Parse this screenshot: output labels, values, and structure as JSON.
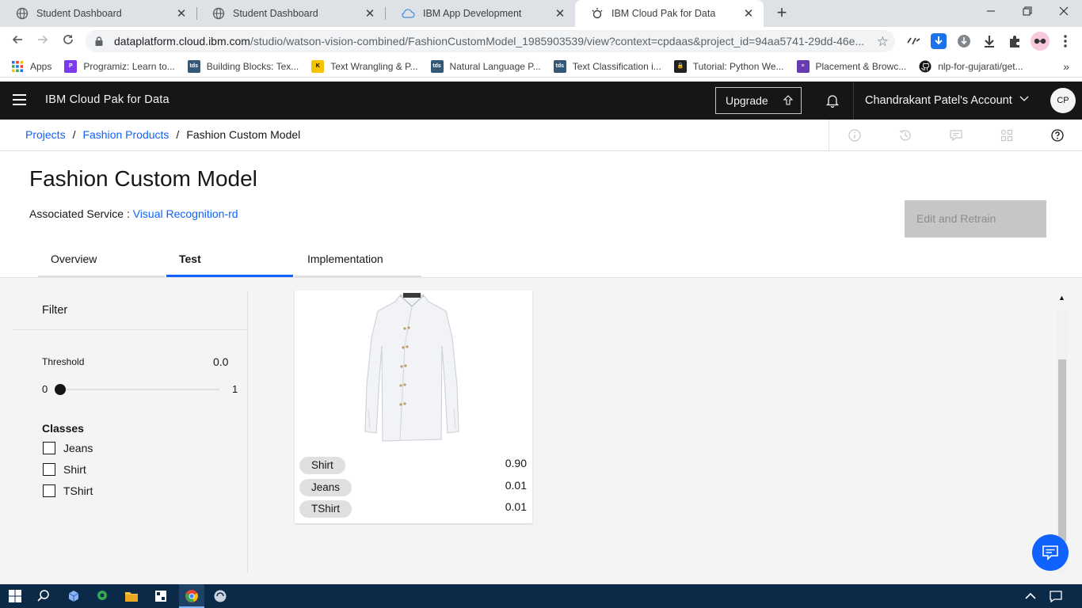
{
  "browser": {
    "tabs": [
      {
        "title": "Student Dashboard",
        "active": false
      },
      {
        "title": "Student Dashboard",
        "active": false
      },
      {
        "title": "IBM App Development",
        "active": false
      },
      {
        "title": "IBM Cloud Pak for Data",
        "active": true
      }
    ],
    "close_glyph": "✕",
    "new_tab_glyph": "+",
    "url_host": "dataplatform.cloud.ibm.com",
    "url_path": "/studio/watson-vision-combined/FashionCustomModel_1985903539/view?context=cpdaas&project_id=94aa5741-29dd-46e...",
    "bookmarks": [
      {
        "label": "Apps",
        "icon": "apps-grid-icon",
        "color": "#4285f4"
      },
      {
        "label": "Programiz: Learn to...",
        "icon": "programiz-icon",
        "color": "#7c3aed"
      },
      {
        "label": "Building Blocks: Tex...",
        "icon": "tds-icon",
        "color": "#355876"
      },
      {
        "label": "Text Wrangling & P...",
        "icon": "k-icon",
        "color": "#f5c400"
      },
      {
        "label": "Natural Language P...",
        "icon": "tds-icon",
        "color": "#355876"
      },
      {
        "label": "Text Classification i...",
        "icon": "tds-icon",
        "color": "#355876"
      },
      {
        "label": "Tutorial: Python We...",
        "icon": "lock-icon",
        "color": "#222222"
      },
      {
        "label": "Placement & Browc...",
        "icon": "list-icon",
        "color": "#6a3ab2"
      },
      {
        "label": "nlp-for-gujarati/get...",
        "icon": "github-icon",
        "color": "#111111"
      }
    ],
    "bookmarks_more": "»"
  },
  "header": {
    "product": "IBM Cloud Pak for Data",
    "upgrade_label": "Upgrade",
    "account_label": "Chandrakant Patel's Account",
    "avatar_initials": "CP"
  },
  "breadcrumb": {
    "items": [
      "Projects",
      "Fashion Products"
    ],
    "current": "Fashion Custom Model",
    "separator": "/"
  },
  "page": {
    "title": "Fashion Custom Model",
    "assoc_label": "Associated Service : ",
    "assoc_link": "Visual Recognition-rd",
    "retrain_label": "Edit and Retrain"
  },
  "tabs": [
    "Overview",
    "Test",
    "Implementation"
  ],
  "active_tab": "Test",
  "filter": {
    "title": "Filter",
    "threshold_label": "Threshold",
    "threshold_value": "0.0",
    "slider_min": "0",
    "slider_max": "1",
    "classes_label": "Classes",
    "classes": [
      "Jeans",
      "Shirt",
      "TShirt"
    ]
  },
  "result_card": {
    "image": "white-shirt-image",
    "predictions": [
      {
        "label": "Shirt",
        "score": "0.90"
      },
      {
        "label": "Jeans",
        "score": "0.01"
      },
      {
        "label": "TShirt",
        "score": "0.01"
      }
    ]
  },
  "colors": {
    "accent": "#0f62fe",
    "header_bg": "#161616",
    "taskbar": "#0b2a47"
  }
}
